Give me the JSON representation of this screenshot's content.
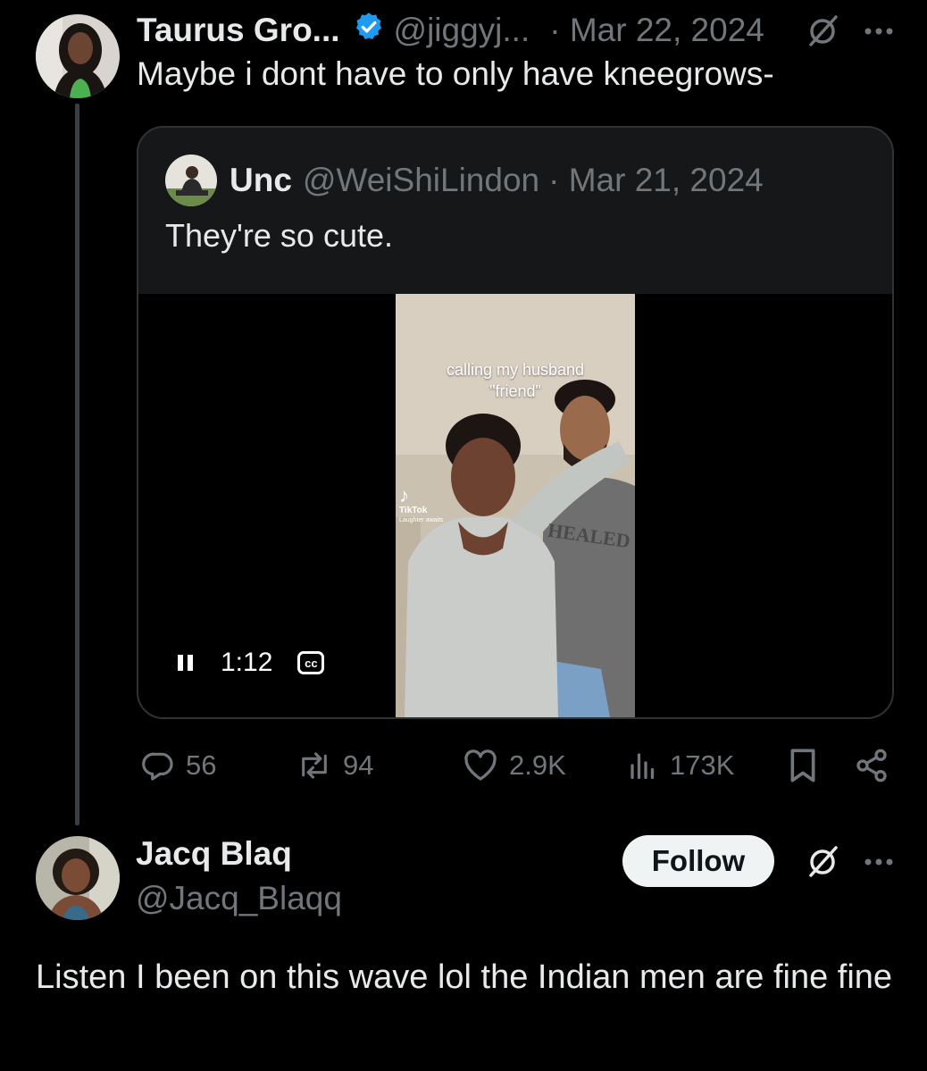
{
  "tweet1": {
    "name": "Taurus Gro...",
    "handle": "@jiggyj...",
    "date": "· Mar 22, 2024",
    "text": "Maybe i dont have to only have kneegrows-",
    "quote": {
      "name": "Unc",
      "handle": "@WeiShiLindon",
      "date": "· Mar 21, 2024",
      "text": "They're so cute.",
      "video": {
        "caption_line1": "calling my husband",
        "caption_line2": "\"friend\"",
        "watermark": "TikTok",
        "watermark_user": "Laughter awaits",
        "shirt_text": "HEALED",
        "time": "1:12",
        "cc_label": "cc"
      }
    },
    "stats": {
      "replies": "56",
      "reposts": "94",
      "likes": "2.9K",
      "views": "173K"
    }
  },
  "tweet2": {
    "name": "Jacq Blaq",
    "handle": "@Jacq_Blaqq",
    "follow_label": "Follow",
    "text": "Listen I been on this wave lol the Indian men are fine fine"
  },
  "colors": {
    "background": "#000000",
    "text_primary": "#e7e9ea",
    "text_muted": "#71767b",
    "verified_blue": "#1d9bf0",
    "follow_bg": "#eff3f4"
  },
  "icons": [
    "verified-badge-icon",
    "grok-icon",
    "more-icon",
    "reply-icon",
    "repost-icon",
    "like-icon",
    "views-icon",
    "bookmark-icon",
    "share-icon",
    "pause-icon",
    "captions-icon",
    "tiktok-icon"
  ]
}
